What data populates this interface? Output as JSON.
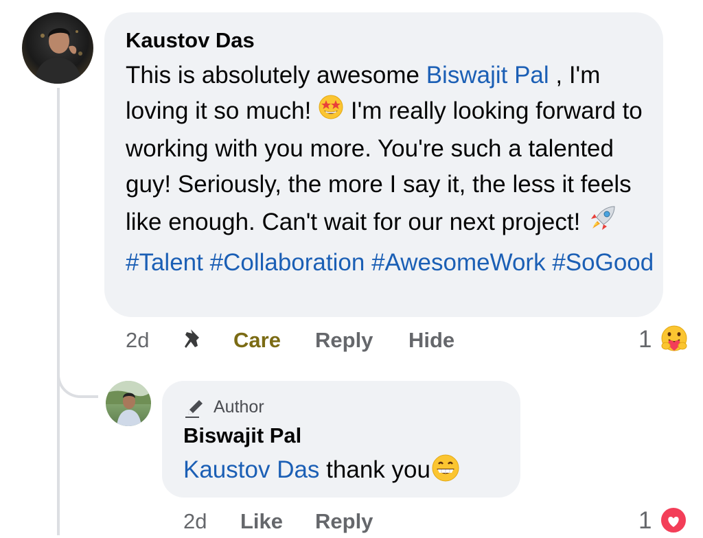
{
  "comment": {
    "author": "Kaustov Das",
    "text_before_mention": "This is absolutely awesome ",
    "mention": "Biswajit Pal",
    "text_after_mention": " , I'm loving it so much! ",
    "text_after_emoji": " I'm really looking forward to working with you more. You're such a talented guy! Seriously, the more I say it, the less it feels like enough. Can't wait for our next project! ",
    "hashtags": [
      "#Talent",
      "#Collaboration",
      "#AwesomeWork",
      "#SoGood"
    ],
    "emojis": [
      "star-struck-emoji",
      "rocket-emoji"
    ],
    "timestamp": "2d",
    "reaction_label": "Care",
    "reply_label": "Reply",
    "hide_label": "Hide",
    "reaction_count": "1",
    "reaction_icon": "care-reaction-icon"
  },
  "reply": {
    "badge": "Author",
    "author": "Biswajit Pal",
    "mention": "Kaustov Das",
    "text": " thank you",
    "emoji": "grinning-emoji",
    "timestamp": "2d",
    "like_label": "Like",
    "reply_label": "Reply",
    "reaction_count": "1",
    "reaction_icon": "love-reaction-icon"
  },
  "colors": {
    "link": "#1b5fb5",
    "bubble": "#f0f2f5",
    "secondary_text": "#65676b",
    "care_label": "#7b6b14",
    "love": "#f33e58"
  }
}
